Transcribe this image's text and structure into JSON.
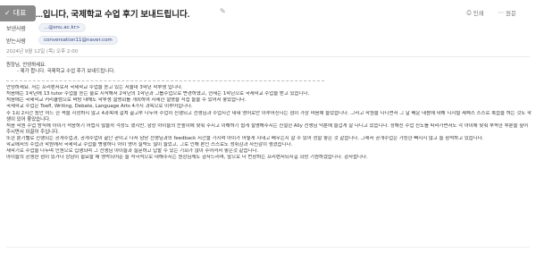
{
  "back_badge": {
    "icon": "check-icon",
    "label": "대표"
  },
  "subject": "...입니다, 국제학교 수업 후기 보내드립니다.",
  "top_actions": [
    {
      "icon": "print-icon",
      "label": "인쇄"
    },
    {
      "icon": "more-icon",
      "label": "원문"
    }
  ],
  "meta": {
    "from_label": "보낸사람",
    "from_value": "...@snu.ac.kr>",
    "to_label": "받는사람",
    "to_value": "conversation11@naver.com",
    "date": "2024년 9월 12일 (목) 오후 2:00"
  },
  "body": {
    "intro": [
      "원장님, 안녕하세요.",
      "- 제가 합니다. 국제학교 수업 후기 보내드립니다."
    ],
    "paragraphs": [
      "안녕하세요. 저는 프리랜서로서 국제학교 수업을 듣고 있는 서울대 3학년 학부생 입니다.",
      "처음에는 1학년에 13 tutor 수업을 듣는 줄로 시작해서 2학년의 1학년과 그룹수업으로 변경하였고, 현재는 1학년으로 국제학교 수업을 받고 있습니다.",
      "처음에는 국제학교 커리큘럼으로 바탕 대해도 학부생 설명회를 개최하여 자세한 설명을 직접 들을 수 있어서 좋았습니다.",
      "국제학교 수업은 Toefl, Writing, Debate, Language Arts 4가지 과목으로 이루어집니다.",
      "주 1회 2시간 동안 어느 한 책을 지정하지 않고 4과목에 걸쳐 골고루 나누어 수업이 진행되고 선생님과 수업시간 내내 영어로만 이루어진다는 점이 가장 마음에 들었습니다. 그리고 학원을 다니면서 그 날 배운 내용에 대해 디지털 세렉스 스스로 복습을 하는 것도 학생이 있어 좋았습니다.",
      "처음 학원 수업 방식에 아이가 적응하기 어렵지 않을까 걱정도 했지만, 항상 아이들의 눈높이에 맞춰 주시고 이해하기 쉽게 설명해주시는 친절한 Ally 선생님 덕분에 즐겁게 잘 다니고 있습니다. 정해진 수업 진도를 따라가면서도 각 아이에 맞춰 부족한 부분을 짚어주시면서 이끌어 주십니다.",
      "또한 분기별로 진행되는 공개수업과, 공개수업이 끝난 곧이고 나서 담당 선생님과의 feedback 시간을 가지며 아이가 어떻게 지내고 배우는지 잘 수 있어 정말 좋은 것 같습니다. 그래서 공개수업은 가능한 빠지지 않고 늘 참석하고 있습니다.",
      "학교에서의 수업과 학원에서 국제학교 수업을 병행하니 아이 영어 실력도 많이 늘었고, 그로 인해 본인 스스로도 성취감과 자신감이 생겼습니다.",
      "새학기로 수업을 나누며 인원으로 집행되며 그 선생님 아이들과 질문하고 답할 수 있는 기회가 많이 주어져서 좋은것 같습니다.",
      "아이들의 공생환 점이 있거나 상담이 필요할 때 영락되어준 늘 적극적으로 대해주시는 원장님께도 감사드리며, 앞으로 더 번창하는 프리랜서되시길 희망 기원하겠습니다. 감사합니다."
    ]
  }
}
